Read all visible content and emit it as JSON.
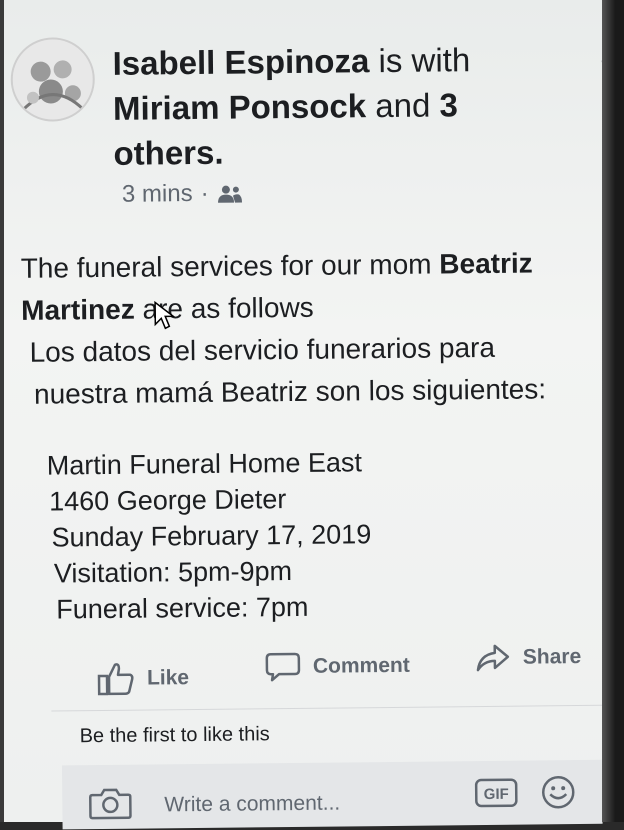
{
  "post": {
    "author": "Isabell Espinoza",
    "with_text": "is with",
    "tagged": "Miriam Ponsock",
    "and_text": "and",
    "others_count": "3",
    "others_text": "others.",
    "time": "3 mins",
    "privacy_separator": "·",
    "privacy_icon": "friends-icon",
    "body_line1_a": "The funeral services for our mom ",
    "body_line1_b": "Beatriz",
    "body_line2_a": "Martinez",
    "body_line2_b": " are as follows",
    "body_line3": "Los datos del servicio funerarios para",
    "body_line4": "nuestra mamá Beatriz son los siguientes:",
    "details": [
      "Martin Funeral Home East",
      "1460 George Dieter",
      "Sunday February 17, 2019",
      "Visitation: 5pm-9pm",
      "Funeral service: 7pm"
    ]
  },
  "actions": {
    "like": "Like",
    "comment": "Comment",
    "share": "Share"
  },
  "likes_summary": "Be the first to like this",
  "comment_input": {
    "placeholder": "Write a comment...",
    "gif_label": "GIF"
  },
  "icons": {
    "camera": "camera-icon",
    "emoji": "emoji-icon",
    "more": "more-options-icon",
    "cursor": "mouse-cursor-icon"
  }
}
